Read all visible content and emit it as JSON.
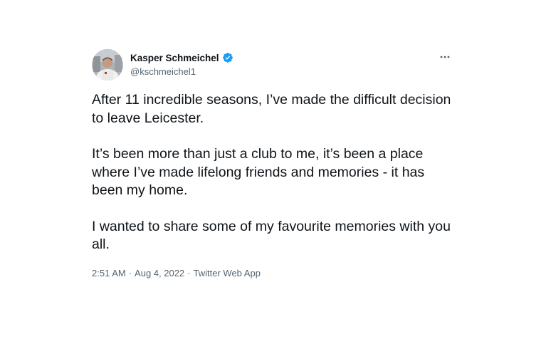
{
  "author": {
    "display_name": "Kasper Schmeichel",
    "handle": "@kschmeichel1",
    "verified": true
  },
  "tweet": {
    "paragraphs": [
      "After 11 incredible seasons, I’ve made the difficult decision to leave Leicester.",
      "It’s been more than just a club to me, it’s been a place where I’ve made lifelong friends and memories - it has been my home.",
      "I wanted to share some of my favourite memories with you all."
    ],
    "time": "2:51 AM",
    "date": "Aug 4, 2022",
    "source": "Twitter Web App",
    "separator": "·"
  },
  "icons": {
    "verified": "verified-badge-icon",
    "more": "more-options-icon"
  },
  "colors": {
    "text_primary": "#0f1419",
    "text_secondary": "#536471",
    "verified_blue": "#1d9bf0"
  }
}
